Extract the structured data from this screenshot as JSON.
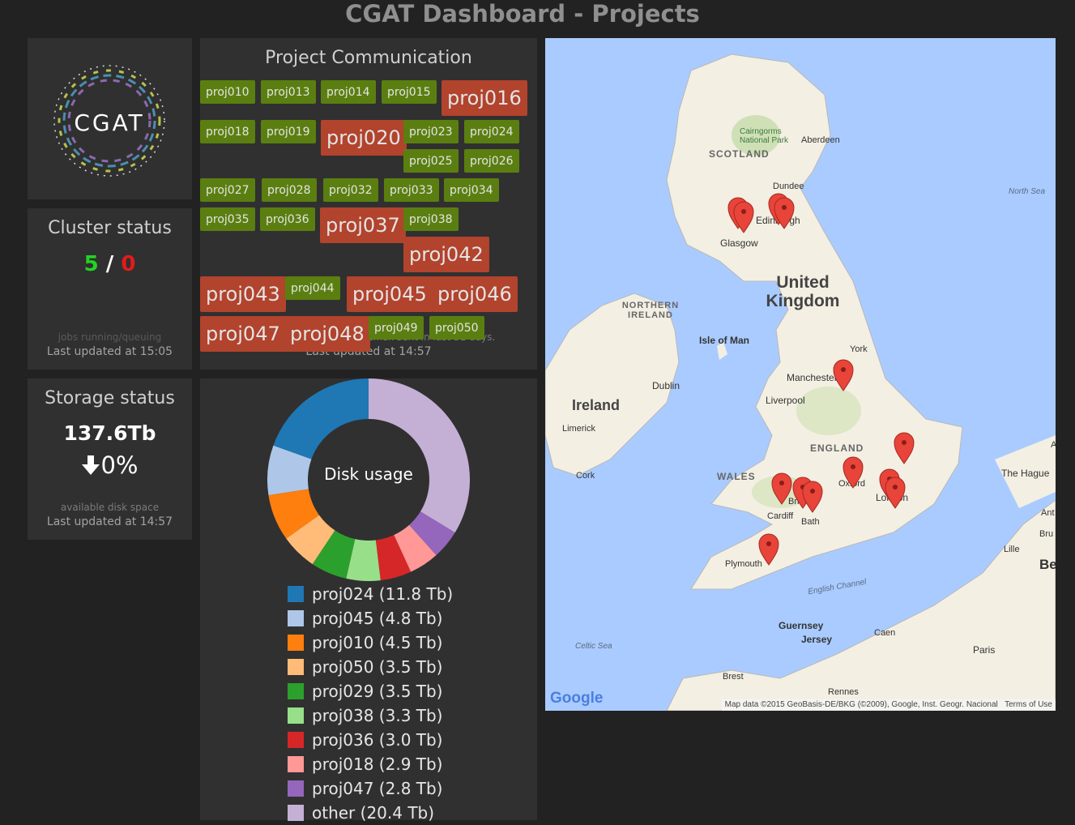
{
  "page": {
    "title": "CGAT Dashboard - Projects"
  },
  "logo": {
    "text": "CGAT"
  },
  "cluster": {
    "title": "Cluster status",
    "running": "5",
    "separator": "/",
    "queuing": "0",
    "more_info": "jobs running/queuing",
    "updated": "Last updated at 15:05"
  },
  "storage": {
    "title": "Storage status",
    "value": "137.6Tb",
    "change_icon": "arrow-down-icon",
    "change": "0%",
    "more_info": "available disk space",
    "updated": "Last updated at 14:57"
  },
  "communication": {
    "title": "Project Communication",
    "more_info": "emails sent to ...; red: no email sent in last 31 days.",
    "updated": "Last updated at 14:57",
    "tags": [
      {
        "label": "proj010",
        "state": "green"
      },
      {
        "label": "proj013",
        "state": "green"
      },
      {
        "label": "proj014",
        "state": "green"
      },
      {
        "label": "proj015",
        "state": "green"
      },
      {
        "label": "proj016",
        "state": "red"
      },
      {
        "label": "proj018",
        "state": "green"
      },
      {
        "label": "proj019",
        "state": "green"
      },
      {
        "label": "proj020",
        "state": "red"
      },
      {
        "label": "proj023",
        "state": "green"
      },
      {
        "label": "proj024",
        "state": "green"
      },
      {
        "label": "proj025",
        "state": "green"
      },
      {
        "label": "proj026",
        "state": "green"
      },
      {
        "label": "proj027",
        "state": "green"
      },
      {
        "label": "proj028",
        "state": "green"
      },
      {
        "label": "proj032",
        "state": "green"
      },
      {
        "label": "proj033",
        "state": "green"
      },
      {
        "label": "proj034",
        "state": "green"
      },
      {
        "label": "proj035",
        "state": "green"
      },
      {
        "label": "proj036",
        "state": "green"
      },
      {
        "label": "proj037",
        "state": "red"
      },
      {
        "label": "proj038",
        "state": "green"
      },
      {
        "label": "proj042",
        "state": "red"
      },
      {
        "label": "proj043",
        "state": "red"
      },
      {
        "label": "proj044",
        "state": "green"
      },
      {
        "label": "proj045",
        "state": "red"
      },
      {
        "label": "proj046",
        "state": "red"
      },
      {
        "label": "proj047",
        "state": "red"
      },
      {
        "label": "proj048",
        "state": "red"
      },
      {
        "label": "proj049",
        "state": "green"
      },
      {
        "label": "proj050",
        "state": "green"
      }
    ],
    "colors": {
      "green": "#5a7f10",
      "red": "#b2432d"
    }
  },
  "disk_chart": {
    "center_label": "Disk usage",
    "chart_data": {
      "type": "pie",
      "title": "Disk usage",
      "unit": "Tb",
      "slices": [
        {
          "name": "proj024",
          "value": 11.8,
          "color": "#1f77b4",
          "label": "proj024 (11.8 Tb)"
        },
        {
          "name": "proj045",
          "value": 4.8,
          "color": "#aec7e8",
          "label": "proj045 (4.8 Tb)"
        },
        {
          "name": "proj010",
          "value": 4.5,
          "color": "#ff7f0e",
          "label": "proj010 (4.5 Tb)"
        },
        {
          "name": "proj050",
          "value": 3.5,
          "color": "#ffbb78",
          "label": "proj050 (3.5 Tb)"
        },
        {
          "name": "proj029",
          "value": 3.5,
          "color": "#2ca02c",
          "label": "proj029 (3.5 Tb)"
        },
        {
          "name": "proj038",
          "value": 3.3,
          "color": "#98df8a",
          "label": "proj038 (3.3 Tb)"
        },
        {
          "name": "proj036",
          "value": 3.0,
          "color": "#d62728",
          "label": "proj036 (3.0 Tb)"
        },
        {
          "name": "proj018",
          "value": 2.9,
          "color": "#ff9896",
          "label": "proj018 (2.9 Tb)"
        },
        {
          "name": "proj047",
          "value": 2.8,
          "color": "#9467bd",
          "label": "proj047 (2.8 Tb)"
        },
        {
          "name": "other",
          "value": 20.4,
          "color": "#c5b0d5",
          "label": "other (20.4 Tb)"
        }
      ]
    }
  },
  "map": {
    "attribution": "Map data ©2015 GeoBasis-DE/BKG (©2009), Google, Inst. Geogr. Nacional",
    "terms": "Terms of Use",
    "google_logo": "Google",
    "labels": [
      "SCOTLAND",
      "Cairngorms National Park",
      "Aberdeen",
      "Dundee",
      "North Sea",
      "Edinburgh",
      "Glasgow",
      "United Kingdom",
      "NORTHERN IRELAND",
      "Isle of Man",
      "York",
      "Manchester",
      "Liverpool",
      "Dublin",
      "Ireland",
      "Limerick",
      "Cork",
      "ENGLAND",
      "WALES",
      "Cardiff",
      "Bristol",
      "Bath",
      "Oxford",
      "London",
      "Plymouth",
      "English Channel",
      "Celtic Sea",
      "Guernsey",
      "Jersey",
      "Caen",
      "Paris",
      "Brest",
      "Rennes",
      "The Hague",
      "Lille",
      "Be",
      "Ant",
      "Bru",
      "A"
    ]
  }
}
